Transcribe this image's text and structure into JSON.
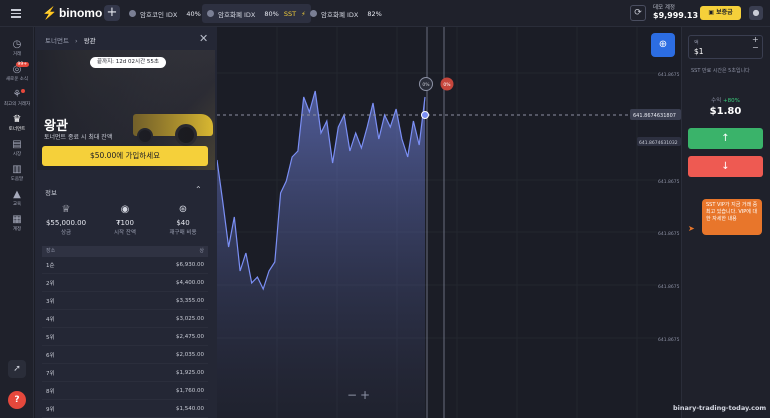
{
  "topbar": {
    "logo": "binomo",
    "tabs": [
      {
        "name": "암호코인 IDX",
        "pct": "40%"
      },
      {
        "name": "암호화폐 IDX",
        "pct": "80%",
        "extra": "SST"
      },
      {
        "name": "암호화폐 IDX",
        "pct": "82%"
      }
    ],
    "account_type": "데모 계정",
    "balance": "$9,999.13",
    "deposit_label": "보증금"
  },
  "leftnav": {
    "items": [
      {
        "icon": "clock-icon",
        "label": "거래"
      },
      {
        "icon": "chat-icon",
        "label": "새로운 소식",
        "badge": "99+"
      },
      {
        "icon": "trophy-icon",
        "label": "최고의 거래자"
      },
      {
        "icon": "cup-icon",
        "label": "토너먼트"
      },
      {
        "icon": "bag-icon",
        "label": "시장"
      },
      {
        "icon": "book-icon",
        "label": "도움말"
      },
      {
        "icon": "grad-icon",
        "label": "교육"
      },
      {
        "icon": "account-icon",
        "label": "계정"
      }
    ]
  },
  "panel": {
    "breadcrumb_root": "토너먼트",
    "breadcrumb_current": "왕관",
    "timer": "끝까지: 12d 02시간 55초",
    "title": "왕관",
    "subtitle": "토너먼트 종료 시 최대 잔액",
    "join_label": "$50.00에 가입하세요",
    "info_heading": "정보",
    "stats": [
      {
        "value": "$55,000.00",
        "label": "상금"
      },
      {
        "value": "₮100",
        "label": "시작 잔액"
      },
      {
        "value": "$40",
        "label": "재구매 비용"
      }
    ],
    "table_head": {
      "left": "장소",
      "right": "상"
    },
    "places": [
      {
        "place": "1순",
        "prize": "$6,930.00"
      },
      {
        "place": "2위",
        "prize": "$4,400.00"
      },
      {
        "place": "3위",
        "prize": "$3,355.00"
      },
      {
        "place": "4위",
        "prize": "$3,025.00"
      },
      {
        "place": "5위",
        "prize": "$2,475.00"
      },
      {
        "place": "6위",
        "prize": "$2,035.00"
      },
      {
        "place": "7위",
        "prize": "$1,925.00"
      },
      {
        "place": "8위",
        "prize": "$1,760.00"
      },
      {
        "place": "9위",
        "prize": "$1,540.00"
      }
    ]
  },
  "chart": {
    "price_current": "641.8674631807",
    "price_line": "641.8674631032",
    "axis_labels": [
      "641.8675",
      "641.8675",
      "641.8675",
      "641.8675",
      "641.8675"
    ],
    "marker_up": "0%",
    "marker_down": "0%",
    "zoom_minus": "−",
    "zoom_plus": "+",
    "colors": {
      "line": "#7b8ff5",
      "dash": "#8c90a3"
    },
    "series": [
      0.31,
      0.45,
      0.6,
      0.5,
      0.68,
      0.62,
      0.72,
      0.7,
      0.74,
      0.68,
      0.65,
      0.42,
      0.38,
      0.3,
      0.28,
      0.1,
      0.15,
      0.08,
      0.22,
      0.18,
      0.32,
      0.2,
      0.16,
      0.28,
      0.22,
      0.27,
      0.2,
      0.12,
      0.24,
      0.16,
      0.2,
      0.14,
      0.24,
      0.3,
      0.18,
      0.26,
      0.1
    ]
  },
  "trade": {
    "amount_label": "액",
    "amount_value": "$1",
    "sst_note": "SST 만료 시간은 5초입니다",
    "profit_label": "수익",
    "profit_pct": "+80%",
    "profit_value": "$1.80",
    "up_symbol": "↑",
    "down_symbol": "↓",
    "vip_text": "SST VIP가 지금 거래 중 최고 있습니다. VIP에 대한 자세한 내용"
  },
  "watermark": "binary-trading-today.com"
}
